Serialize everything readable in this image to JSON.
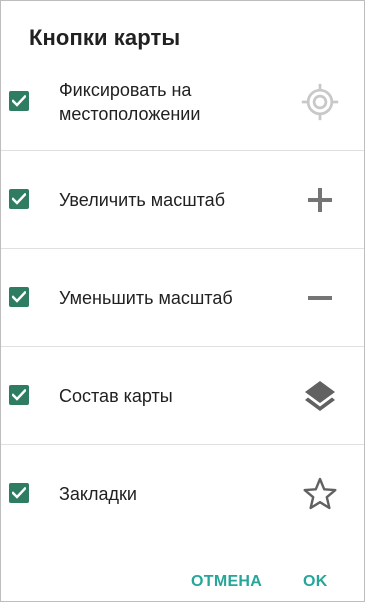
{
  "dialog": {
    "title": "Кнопки карты"
  },
  "items": [
    {
      "label": "Фиксировать на местоположении",
      "checked": true,
      "icon": "location-target-icon"
    },
    {
      "label": "Увеличить масштаб",
      "checked": true,
      "icon": "plus-icon"
    },
    {
      "label": "Уменьшить масштаб",
      "checked": true,
      "icon": "minus-icon"
    },
    {
      "label": "Состав карты",
      "checked": true,
      "icon": "layers-icon"
    },
    {
      "label": "Закладки",
      "checked": true,
      "icon": "star-outline-icon"
    }
  ],
  "buttons": {
    "cancel": "ОТМЕНА",
    "ok": "OK"
  },
  "colors": {
    "checkbox": "#2e7d63",
    "accent_button": "#26a69a",
    "icon_gray": "#757575"
  }
}
